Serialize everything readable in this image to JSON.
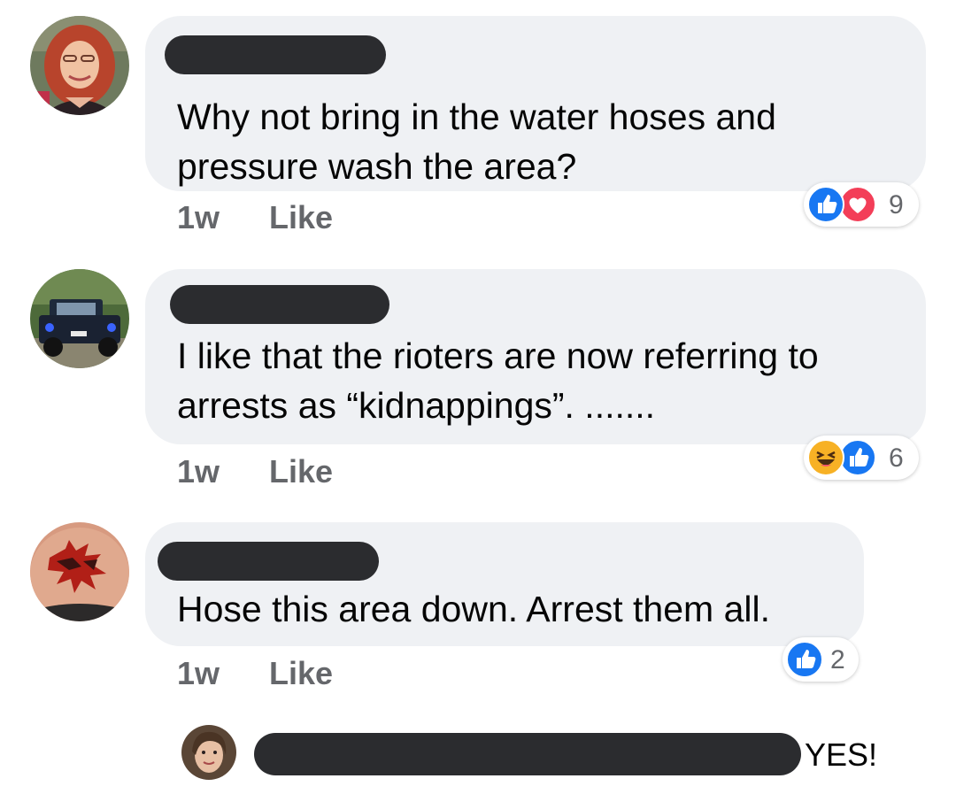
{
  "comments": [
    {
      "text_line1": "Why not bring in the water hoses and",
      "text_line2": "pressure wash the area?",
      "time": "1w",
      "like_label": "Like",
      "reaction_count": "9",
      "reaction_icons": [
        "like-icon",
        "love-icon"
      ]
    },
    {
      "text_line1": "I like that the rioters are now referring to",
      "text_line2": "arrests as “kidnappings”. .......",
      "time": "1w",
      "like_label": "Like",
      "reaction_count": "6",
      "reaction_icons": [
        "haha-icon",
        "like-icon"
      ]
    },
    {
      "text_line1": "Hose this area down. Arrest them all.",
      "time": "1w",
      "like_label": "Like",
      "reaction_count": "2",
      "reaction_icons": [
        "like-icon"
      ]
    }
  ],
  "reply": {
    "text": "YES!"
  },
  "colors": {
    "bubble": "#eff1f4",
    "redaction": "#2b2c2f",
    "meta_text": "#65676b",
    "like_blue": "#1877f2",
    "love_red": "#f33e58",
    "haha_yellow": "#f7b125"
  }
}
